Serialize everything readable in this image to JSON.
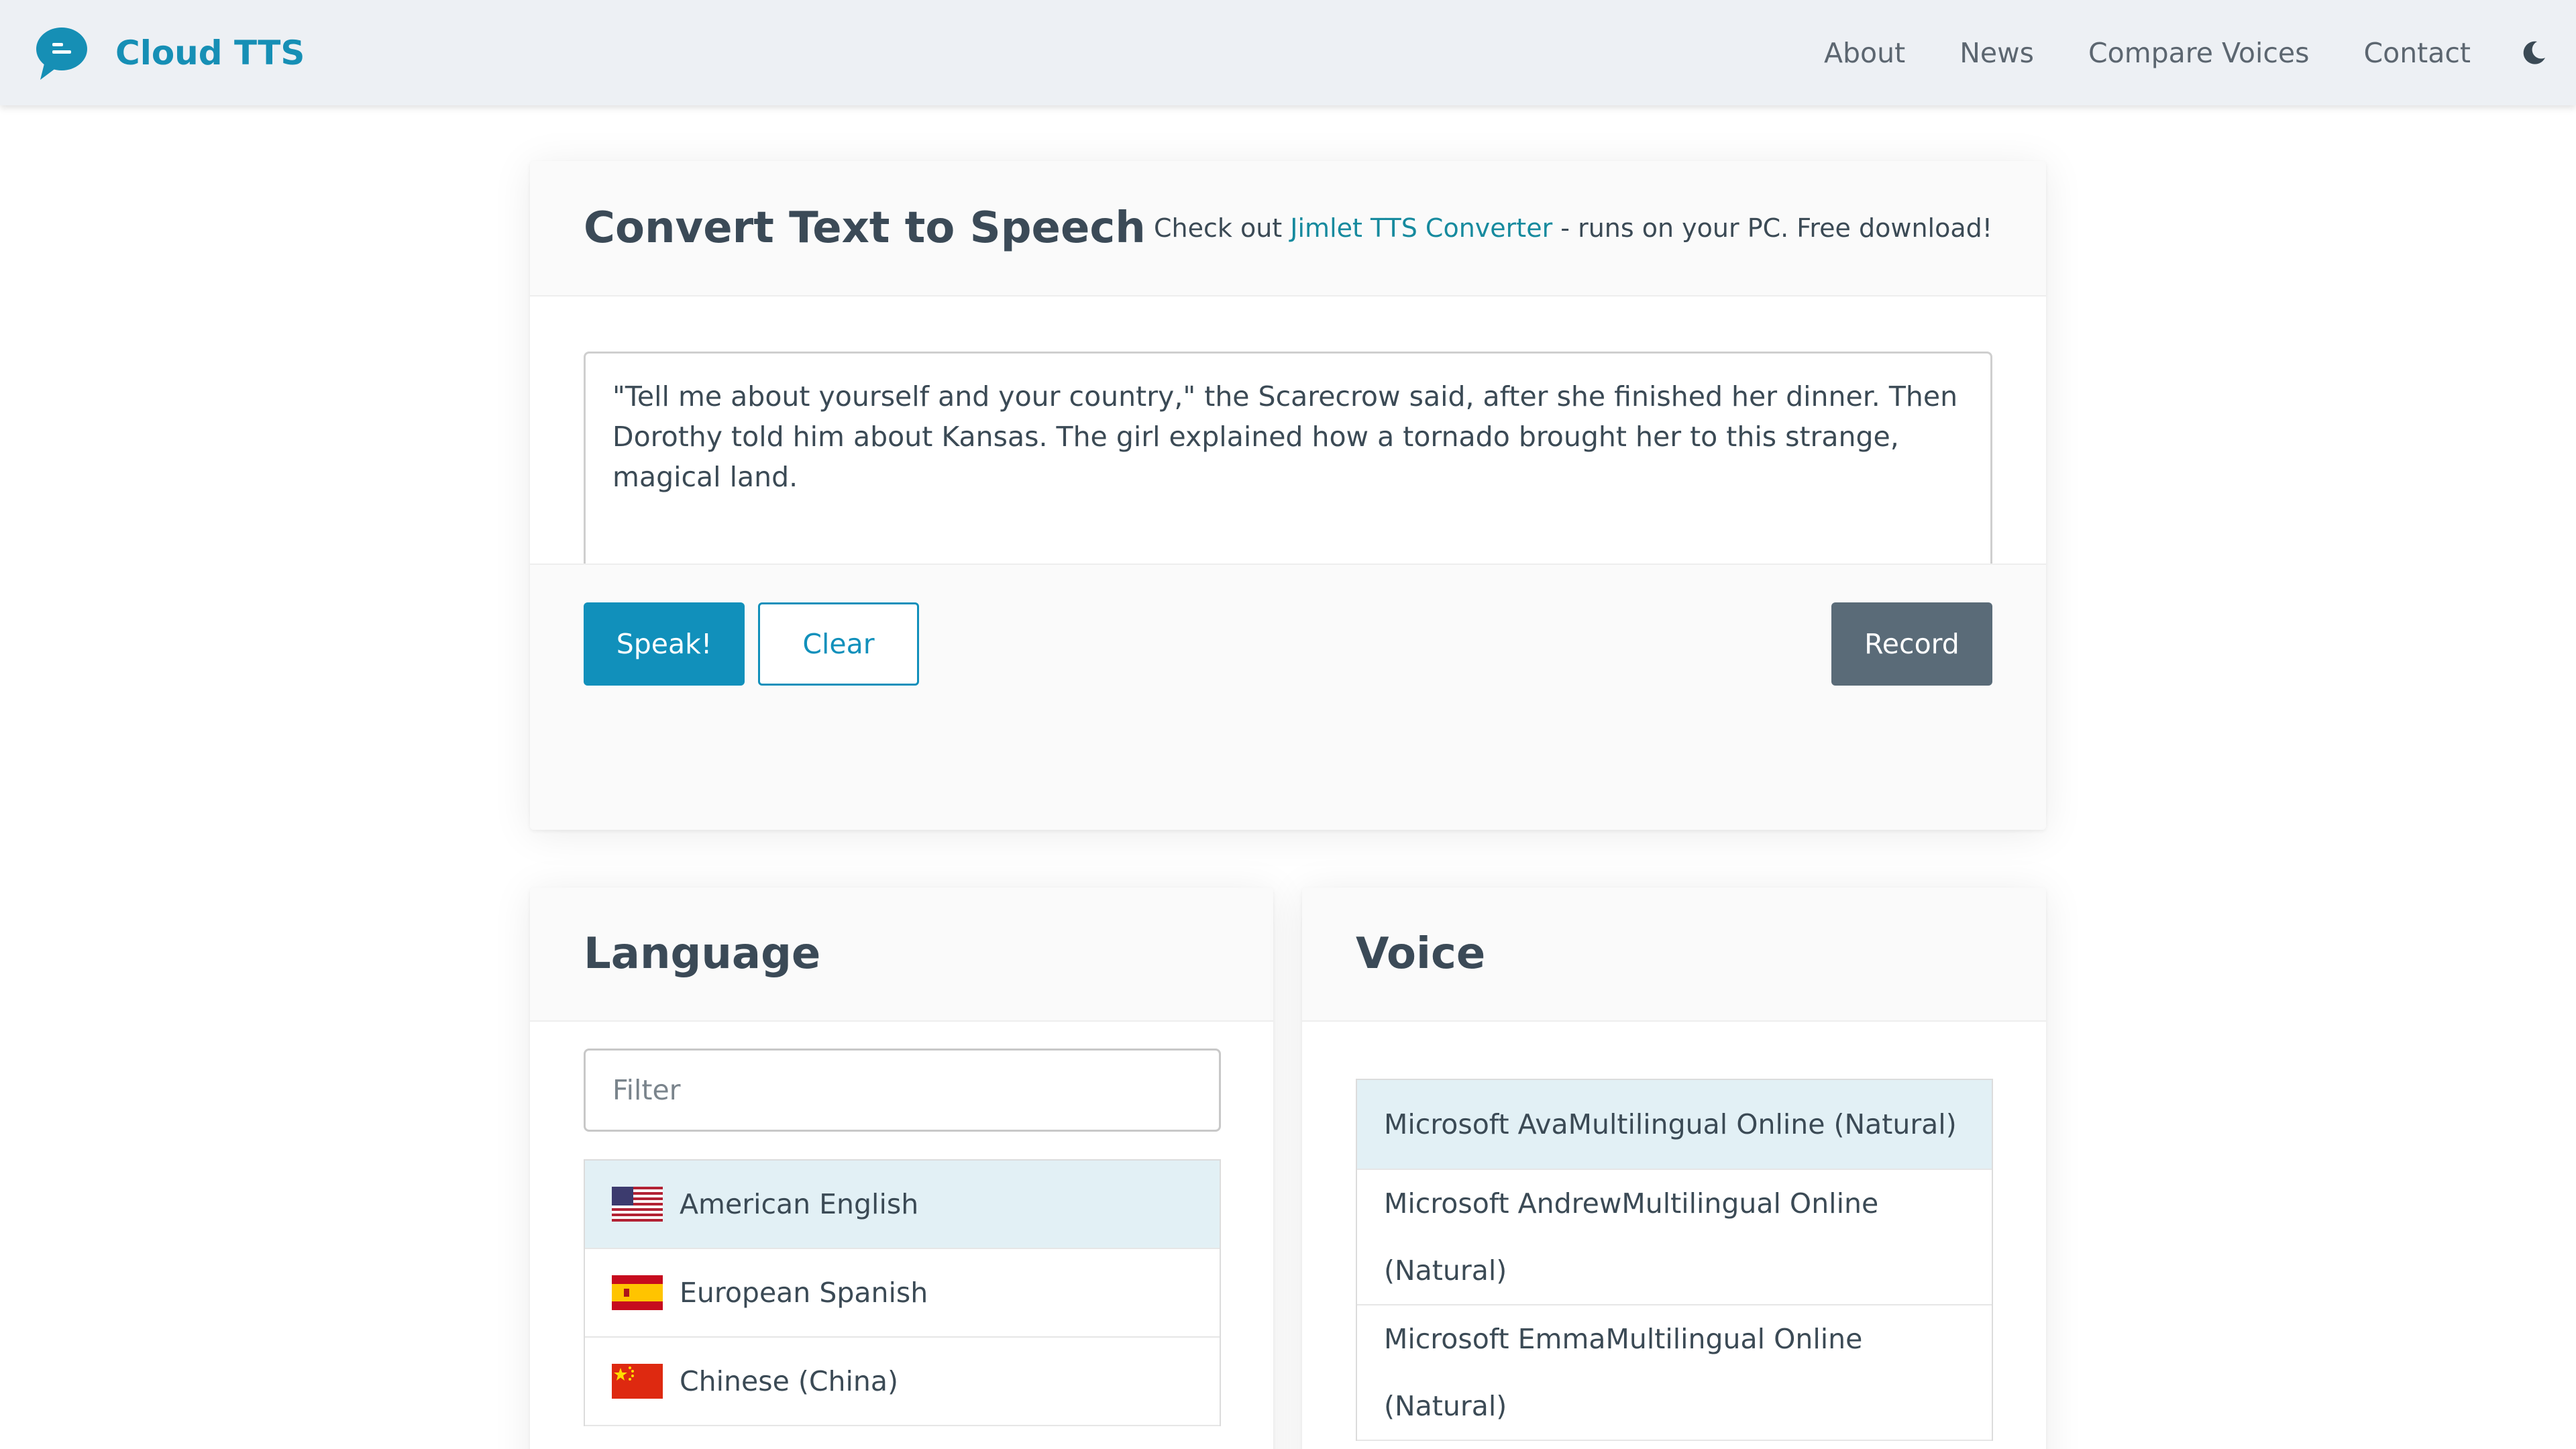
{
  "navbar": {
    "brand": "Cloud TTS",
    "links": [
      "About",
      "News",
      "Compare Voices",
      "Contact"
    ],
    "theme_icon": "moon-icon"
  },
  "main_card": {
    "title": "Convert Text to Speech",
    "promo_prefix": "Check out ",
    "promo_link": "Jimlet TTS Converter",
    "promo_suffix": " - runs on your PC. Free download!",
    "text": "\"Tell me about yourself and your country,\" the Scarecrow said, after she finished her dinner. Then Dorothy told him about Kansas. The girl explained how a tornado brought her to this strange, magical land.",
    "buttons": {
      "speak": "Speak!",
      "clear": "Clear",
      "record": "Record"
    }
  },
  "language_card": {
    "title": "Language",
    "filter_placeholder": "Filter",
    "items": [
      {
        "label": "American English",
        "flag": "us-flag-icon",
        "selected": true
      },
      {
        "label": "European Spanish",
        "flag": "spain-flag-icon",
        "selected": false
      },
      {
        "label": "Chinese (China)",
        "flag": "china-flag-icon",
        "selected": false
      }
    ]
  },
  "voice_card": {
    "title": "Voice",
    "items": [
      {
        "label": "Microsoft AvaMultilingual Online (Natural)",
        "selected": true
      },
      {
        "label": "Microsoft AndrewMultilingual Online (Natural)",
        "selected": false
      },
      {
        "label": "Microsoft EmmaMultilingual Online (Natural)",
        "selected": false
      }
    ]
  },
  "colors": {
    "accent": "#1190bb",
    "brand": "#168fb5",
    "record": "#5a6b78",
    "selected_row": "#e2f0f5",
    "navbar_bg": "#edf0f4"
  }
}
